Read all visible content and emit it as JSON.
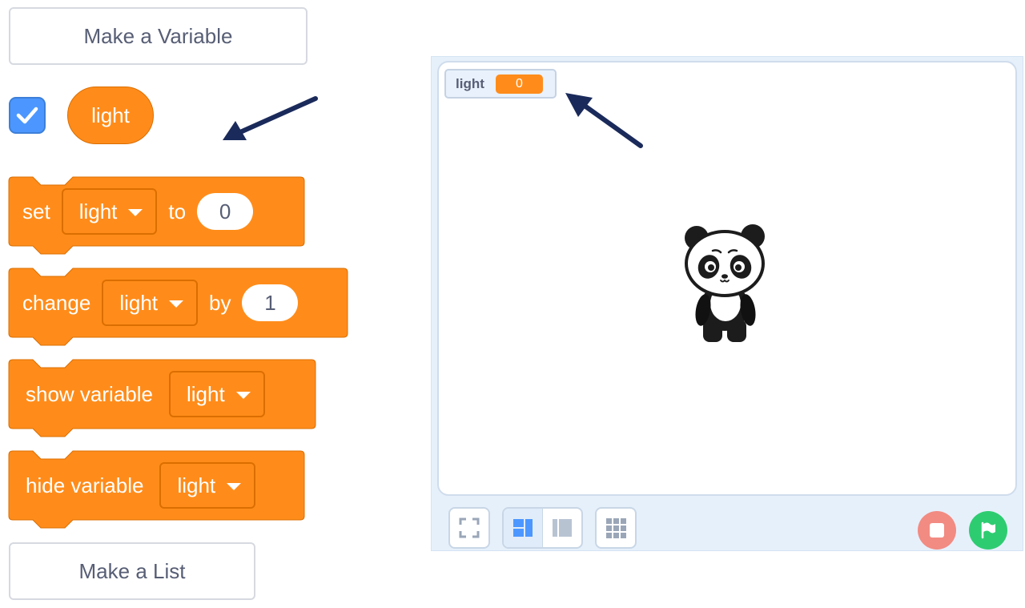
{
  "palette": {
    "make_variable_label": "Make a Variable",
    "make_list_label": "Make a List",
    "variable_name": "light",
    "variable_checked": true,
    "blocks": {
      "set": {
        "label": "set",
        "variable": "light",
        "to_label": "to",
        "value": "0"
      },
      "change": {
        "label": "change",
        "variable": "light",
        "by_label": "by",
        "value": "1"
      },
      "show": {
        "label": "show variable",
        "variable": "light"
      },
      "hide": {
        "label": "hide variable",
        "variable": "light"
      }
    }
  },
  "stage": {
    "monitor": {
      "label": "light",
      "value": "0"
    },
    "sprite": "panda-sprite"
  },
  "colors": {
    "variables_block": "#ff8c1a",
    "variables_block_border": "#db6e00",
    "checkbox": "#4c97ff",
    "arrow": "#1a2a5a",
    "stop_button": "#f28b82",
    "green_flag_button": "#2ecc71",
    "stage_background": "#e6f0fb"
  },
  "icons": {
    "checkbox": "check-icon",
    "fullscreen": "fullscreen-icon",
    "small_stage": "small-stage-icon",
    "large_stage": "large-stage-icon",
    "grid": "grid-icon",
    "stop": "stop-icon",
    "go": "green-flag-icon"
  }
}
